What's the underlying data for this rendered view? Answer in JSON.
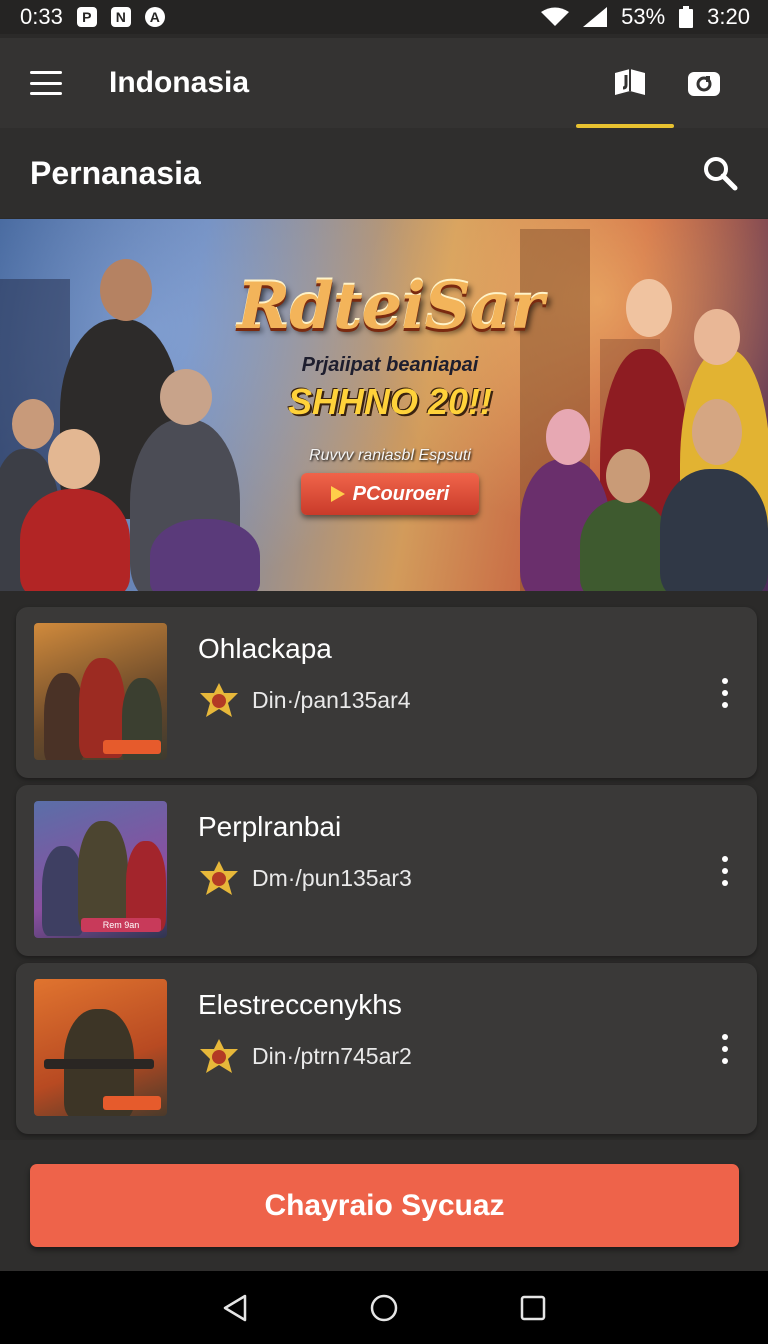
{
  "status": {
    "time_left": "0:33",
    "notifications": [
      "P",
      "N",
      "A"
    ],
    "battery": "53%",
    "time_right": "3:20"
  },
  "appbar": {
    "title": "Indonasia",
    "menu_icon": "menu-icon",
    "actions": [
      {
        "icon": "book-icon",
        "active": true
      },
      {
        "icon": "gamepad-icon",
        "active": false
      }
    ]
  },
  "subheader": {
    "title": "Pernanasia",
    "search_icon": "search-icon"
  },
  "banner": {
    "logo": "RdteiSar",
    "tagline": "Prjaiipat beaniapai",
    "headline": "SHHNO 20!!",
    "small_text": "Ruvvv raniasbl Espsuti",
    "cta": "PCouroeri"
  },
  "items": [
    {
      "title": "Ohlackapa",
      "meta": "Din·/pan135ar4",
      "thumb_colors": [
        "#d08a3c",
        "#6b4a2a",
        "#3e3a2f"
      ]
    },
    {
      "title": "Perplranbai",
      "meta": "Dm·/pun135ar3",
      "thumb_colors": [
        "#5a6fa8",
        "#8a4fa0",
        "#2f3550"
      ]
    },
    {
      "title": "Elestreccenykhs",
      "meta": "Din·/ptrn745ar2",
      "thumb_colors": [
        "#e0742f",
        "#b84a22",
        "#4a3a2a"
      ]
    }
  ],
  "thumb_badges": [
    "",
    "Rem 9an",
    ""
  ],
  "primary_button": "Chayraio Sycuaz",
  "colors": {
    "accent": "#e8c230",
    "primary": "#ee634a",
    "card": "#3a3938",
    "background": "#2b2a29"
  }
}
